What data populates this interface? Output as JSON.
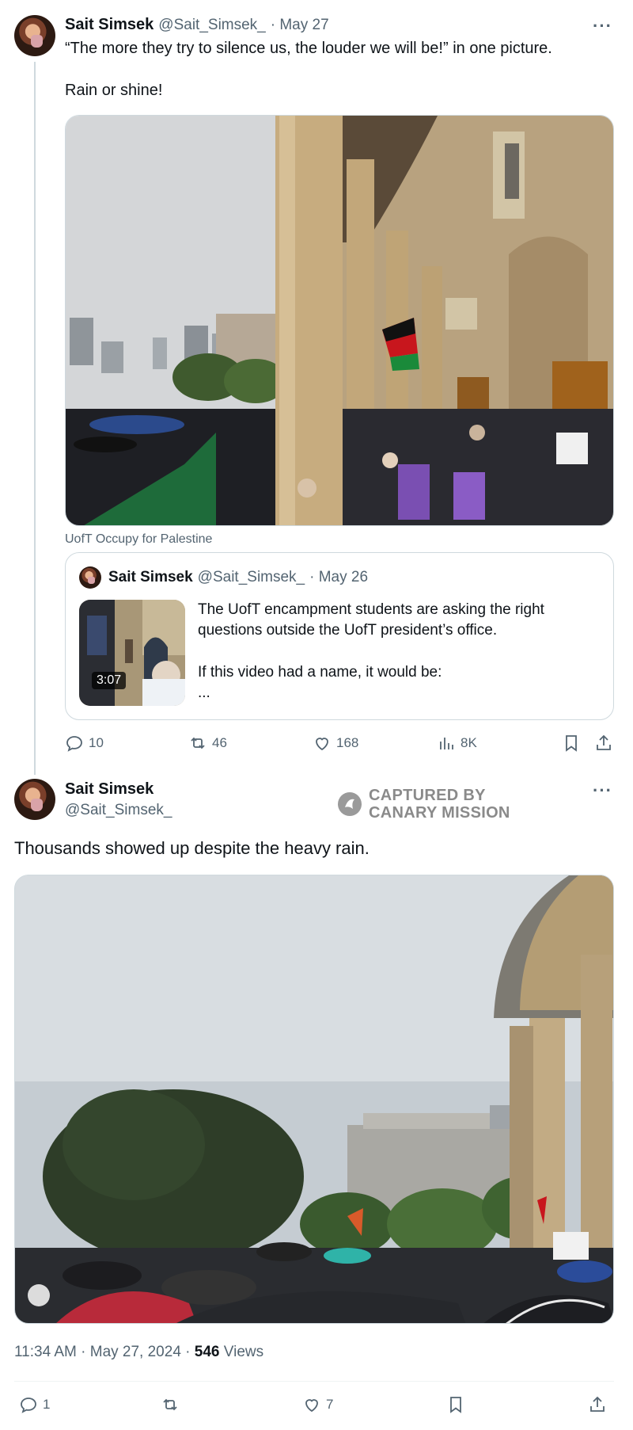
{
  "tweet1": {
    "name": "Sait Simsek",
    "handle": "@Sait_Simsek_",
    "date": "· May 27",
    "text_line1": "“The more they try to silence us, the louder we will be!” in one picture.",
    "text_line2": "Rain or shine!",
    "image_caption": "UofT Occupy for Palestine",
    "more": "···",
    "quote": {
      "name": "Sait Simsek",
      "handle": "@Sait_Simsek_",
      "date": "· May 26",
      "duration": "3:07",
      "text_line1": "The UofT encampment students are asking the right",
      "text_line2": "questions outside the UofT president’s office.",
      "text_line3": "If this video had a name, it would be:",
      "text_line4": "..."
    },
    "actions": {
      "replies": "10",
      "reposts": "46",
      "likes": "168",
      "views": "8K"
    }
  },
  "tweet2": {
    "name": "Sait Simsek",
    "handle": "@Sait_Simsek_",
    "more": "···",
    "text": "Thousands showed up despite the heavy rain.",
    "time": "11:34 AM · May 27, 2024 · ",
    "views_count": "546",
    "views_label": " Views",
    "actions": {
      "replies": "1",
      "likes": "7"
    }
  },
  "watermark": {
    "line1": "CAPTURED BY",
    "line2": "CANARY MISSION"
  },
  "icons": [
    "reply-icon",
    "repost-icon",
    "like-icon",
    "views-icon",
    "bookmark-icon",
    "share-icon",
    "play-icon"
  ]
}
